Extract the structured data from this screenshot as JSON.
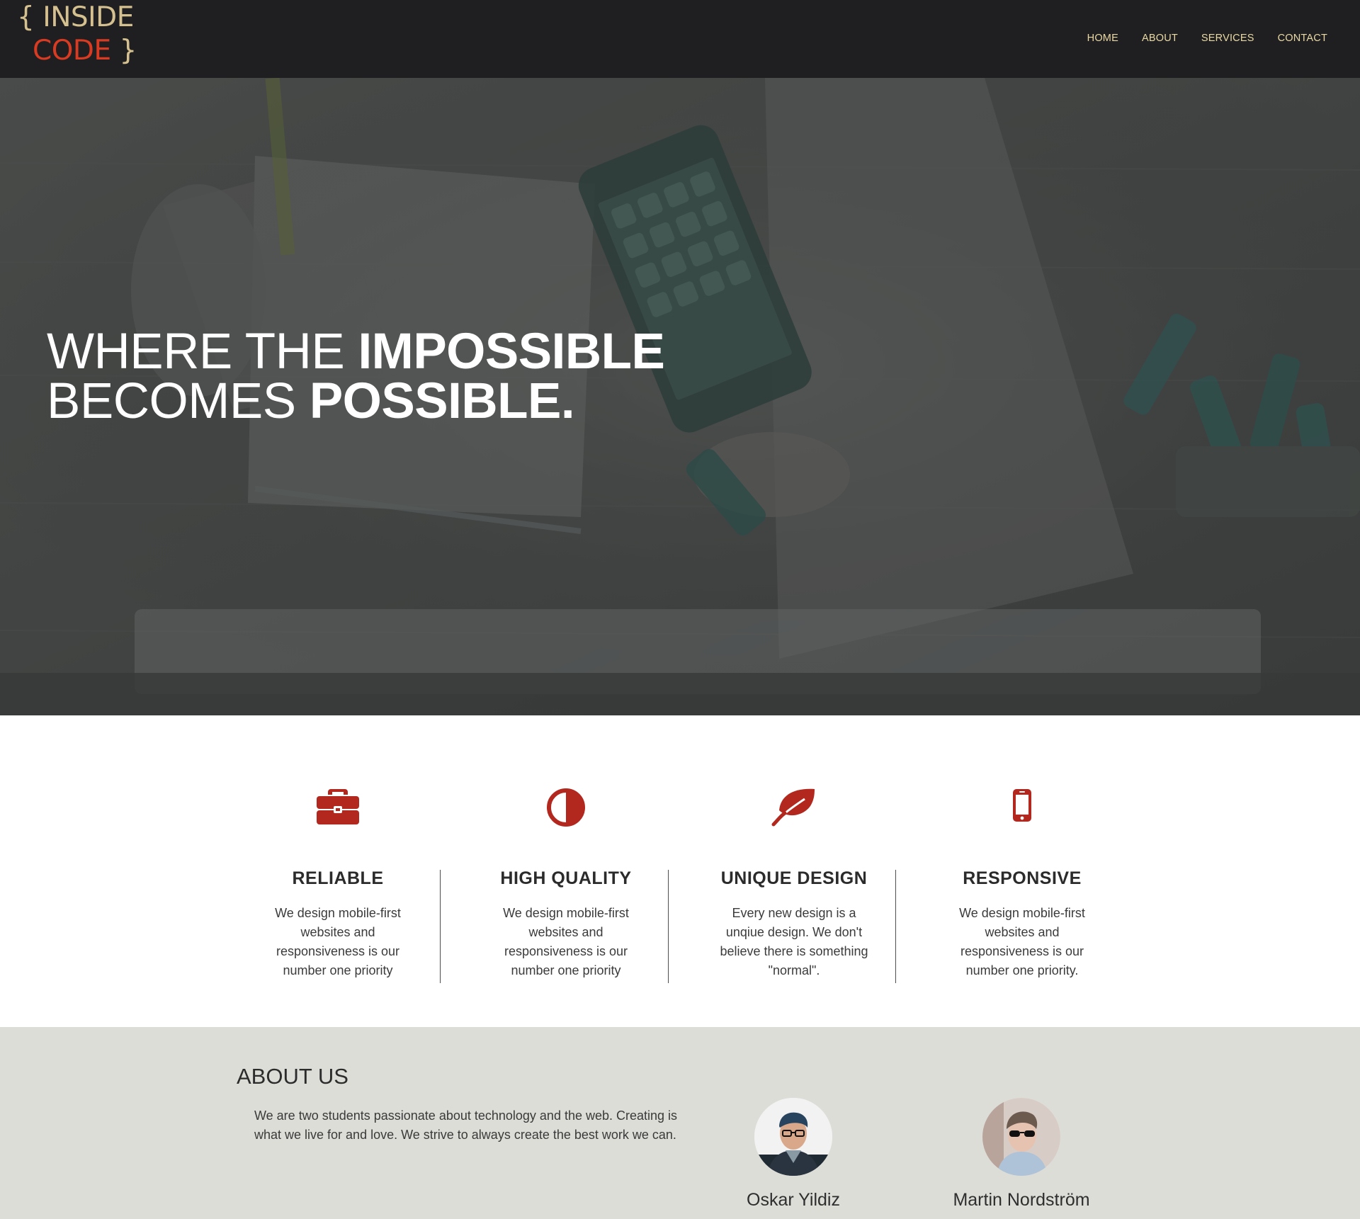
{
  "header": {
    "logo": {
      "open_brace": "{",
      "word1": "INSIDE",
      "word2": "CODE",
      "close_brace": "}"
    },
    "nav": [
      {
        "label": "HOME"
      },
      {
        "label": "ABOUT"
      },
      {
        "label": "SERVICES"
      },
      {
        "label": "CONTACT"
      }
    ]
  },
  "hero": {
    "line1_light": "WHERE THE",
    "line1_bold": "IMPOSSIBLE",
    "line2_light": "BECOMES",
    "line2_bold": "POSSIBLE."
  },
  "features": [
    {
      "icon": "briefcase-icon",
      "title": "RELIABLE",
      "text": "We design mobile-first websites and responsiveness is our number one priority"
    },
    {
      "icon": "contrast-icon",
      "title": "HIGH QUALITY",
      "text": "We design mobile-first websites and responsiveness is our number one priority"
    },
    {
      "icon": "leaf-icon",
      "title": "UNIQUE DESIGN",
      "text": "Every new design is a unqiue design. We don't believe there is something \"normal\"."
    },
    {
      "icon": "mobile-phone-icon",
      "title": "RESPONSIVE",
      "text": "We design mobile-first websites and responsiveness is our number one priority."
    }
  ],
  "about": {
    "title": "ABOUT US",
    "text": "We are two students passionate about technology and the web. Creating is what we live for and love. We strive to always create the best work we can.",
    "members": [
      {
        "name": "Oskar Yildiz"
      },
      {
        "name": "Martin Nordström"
      }
    ]
  },
  "colors": {
    "nav_bg": "#1f1f21",
    "accent_red": "#b2281f",
    "logo_gold": "#d5c08f",
    "logo_red": "#d93b22",
    "about_bg": "#ddddd8"
  }
}
